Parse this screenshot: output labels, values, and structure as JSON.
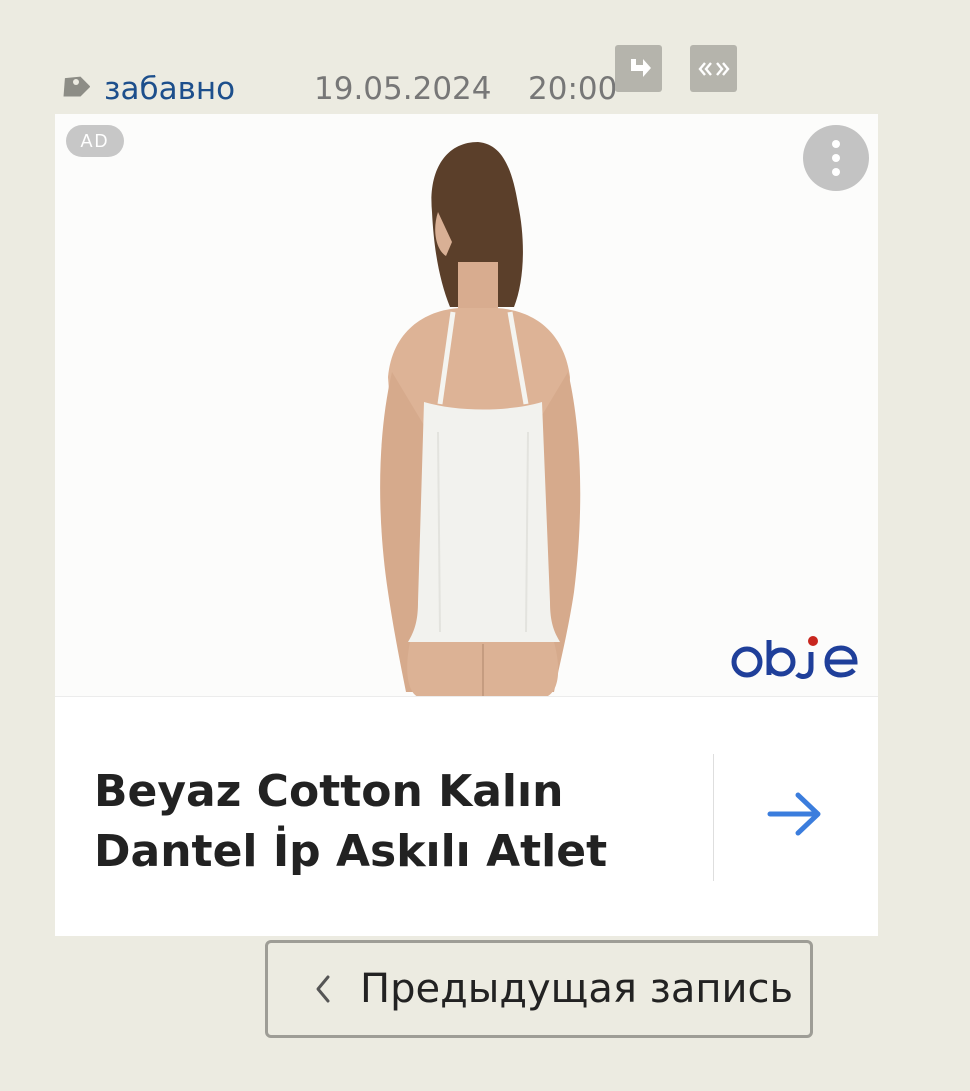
{
  "meta": {
    "tag_label": "забавно",
    "date": "19.05.2024",
    "time": "20:00"
  },
  "icons": {
    "tag": "tag-icon",
    "repost": "repost-icon",
    "quote": "quote-icon",
    "menu": "more-vertical-icon",
    "arrow": "arrow-right-icon",
    "chevron": "chevron-left-icon"
  },
  "ad": {
    "badge": "AD",
    "brand": "obje",
    "title": "Beyaz Cotton Kalın Dantel İp Askılı Atlet",
    "accent_color": "#3b7ddd"
  },
  "navigation": {
    "prev_label": "Предыдущая запись"
  },
  "colors": {
    "background": "#ecebe1",
    "link": "#1d4f8c",
    "button_gray": "#b5b4ac",
    "brand_blue": "#1f3f9a",
    "brand_red": "#c8261e"
  }
}
